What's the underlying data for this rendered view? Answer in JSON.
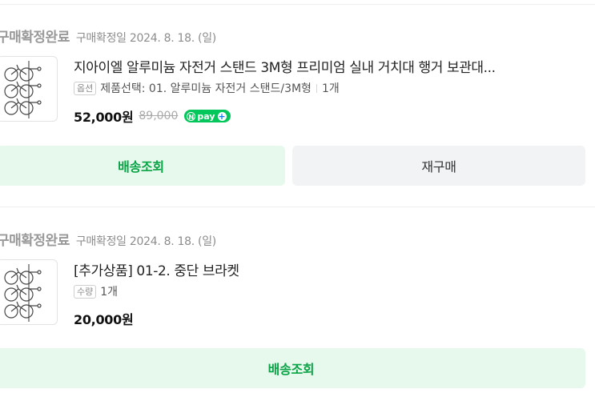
{
  "orders": [
    {
      "status": "구매확정완료",
      "confirm_date": "구매확정일 2024. 8. 18. (일)",
      "thumbnail_icon": "bicycle-stand-icon",
      "title": "지아이엘 알루미늄 자전거 스탠드 3M형 프리미엄 실내 거치대 행거 보관대...",
      "option_badge": "옵션",
      "option_text": "제품선택: 01. 알루미늄 자전거 스탠드/3M형",
      "quantity": "1개",
      "price": "52,000원",
      "original_price": "89,000",
      "npay_label": "pay",
      "buttons": [
        "배송조회",
        "재구매"
      ]
    },
    {
      "status": "구매확정완료",
      "confirm_date": "구매확정일 2024. 8. 18. (일)",
      "thumbnail_icon": "bicycle-stand-icon",
      "title": "[추가상품] 01-2. 중단 브라켓",
      "option_badge": "수량",
      "quantity": "1개",
      "price": "20,000원",
      "buttons": [
        "배송조회"
      ]
    }
  ],
  "colors": {
    "accent_green": "#03c75a",
    "button_green_bg": "#e6f9ec",
    "button_green_text": "#08a345",
    "button_gray_bg": "#f2f3f5"
  }
}
